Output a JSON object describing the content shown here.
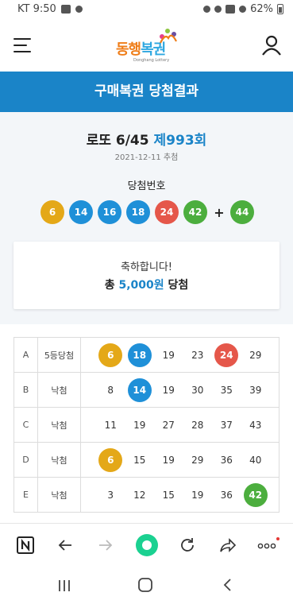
{
  "status_bar": {
    "carrier_time": "KT 9:50",
    "battery": "62%"
  },
  "header": {
    "logo_text_1": "동행",
    "logo_text_2": "복권",
    "logo_sub": "Donghang Lottery"
  },
  "title_bar": {
    "title": "구매복권 당첨결과"
  },
  "draw": {
    "name": "로또 6/45",
    "round": "제993회",
    "date": "2021-12-11 추첨",
    "winning_label": "당첨번호",
    "numbers": [
      {
        "value": "6",
        "color": "yellow"
      },
      {
        "value": "14",
        "color": "blue"
      },
      {
        "value": "16",
        "color": "blue"
      },
      {
        "value": "18",
        "color": "blue"
      },
      {
        "value": "24",
        "color": "red"
      },
      {
        "value": "42",
        "color": "green"
      }
    ],
    "plus": "+",
    "bonus": {
      "value": "44",
      "color": "green"
    }
  },
  "congrats": {
    "line1": "축하합니다!",
    "prefix": "총",
    "amount": "5,000원",
    "suffix": "당첨"
  },
  "games": [
    {
      "slot": "A",
      "status": "5등당첨",
      "numbers": [
        {
          "value": "6",
          "hit": "yellow"
        },
        {
          "value": "18",
          "hit": "blue"
        },
        {
          "value": "19",
          "hit": ""
        },
        {
          "value": "23",
          "hit": ""
        },
        {
          "value": "24",
          "hit": "red"
        },
        {
          "value": "29",
          "hit": ""
        }
      ]
    },
    {
      "slot": "B",
      "status": "낙첨",
      "numbers": [
        {
          "value": "8",
          "hit": ""
        },
        {
          "value": "14",
          "hit": "blue"
        },
        {
          "value": "19",
          "hit": ""
        },
        {
          "value": "30",
          "hit": ""
        },
        {
          "value": "35",
          "hit": ""
        },
        {
          "value": "39",
          "hit": ""
        }
      ]
    },
    {
      "slot": "C",
      "status": "낙첨",
      "numbers": [
        {
          "value": "11",
          "hit": ""
        },
        {
          "value": "19",
          "hit": ""
        },
        {
          "value": "27",
          "hit": ""
        },
        {
          "value": "28",
          "hit": ""
        },
        {
          "value": "37",
          "hit": ""
        },
        {
          "value": "43",
          "hit": ""
        }
      ]
    },
    {
      "slot": "D",
      "status": "낙첨",
      "numbers": [
        {
          "value": "6",
          "hit": "yellow"
        },
        {
          "value": "15",
          "hit": ""
        },
        {
          "value": "19",
          "hit": ""
        },
        {
          "value": "29",
          "hit": ""
        },
        {
          "value": "36",
          "hit": ""
        },
        {
          "value": "40",
          "hit": ""
        }
      ]
    },
    {
      "slot": "E",
      "status": "낙첨",
      "numbers": [
        {
          "value": "3",
          "hit": ""
        },
        {
          "value": "12",
          "hit": ""
        },
        {
          "value": "15",
          "hit": ""
        },
        {
          "value": "19",
          "hit": ""
        },
        {
          "value": "36",
          "hit": ""
        },
        {
          "value": "42",
          "hit": "green"
        }
      ]
    }
  ],
  "icons": {
    "menu": "hamburger-menu-icon",
    "user": "user-icon",
    "n_home": "naver-n-icon",
    "back": "arrow-left-icon",
    "forward": "arrow-right-icon",
    "green_dot": "green-circle-icon",
    "refresh": "refresh-icon",
    "share": "share-arrow-icon",
    "more": "more-dots-icon"
  },
  "colors": {
    "brand_blue": "#1a84c8",
    "yellow": "#e4a818",
    "blue": "#1f90d8",
    "red": "#e5574a",
    "green": "#4cae3e"
  }
}
